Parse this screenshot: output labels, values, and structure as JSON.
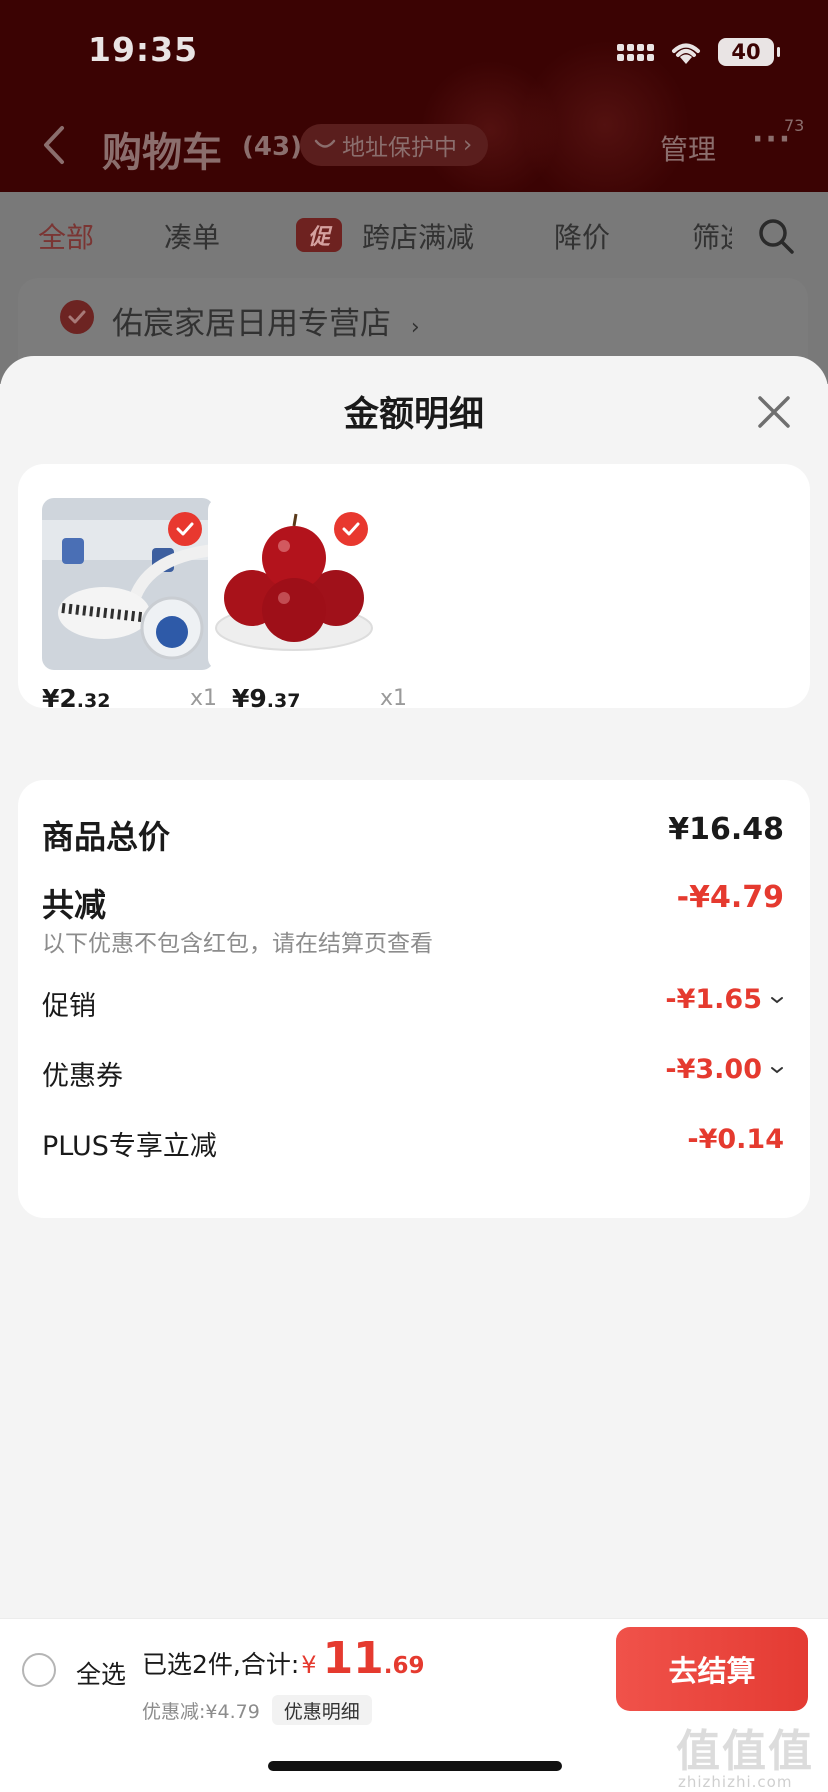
{
  "status_bar": {
    "time": "19:35",
    "battery": "40"
  },
  "nav": {
    "title": "购物车",
    "count": "(43)",
    "address_protect": "地址保护中",
    "manage": "管理",
    "more": "···",
    "badge": "73"
  },
  "filters": {
    "tabs": [
      "全部",
      "凑单",
      "跨店满减",
      "降价",
      "筛选"
    ],
    "promo_tag": "促"
  },
  "store": {
    "name": "佑宸家居日用专营店"
  },
  "sheet": {
    "title": "金额明细",
    "goods": [
      {
        "name": "toilet-brush",
        "price_int": "¥2",
        "price_dec": ".32",
        "qty": "x1"
      },
      {
        "name": "red-apples",
        "price_int": "¥9",
        "price_dec": ".37",
        "qty": "x1"
      }
    ],
    "summary": {
      "total_label": "商品总价",
      "total_value": "¥16.48",
      "reduce_label": "共减",
      "reduce_value": "-¥4.79",
      "reduce_note": "以下优惠不包含红包，请在结算页查看",
      "promo_label": "促销",
      "promo_value": "-¥1.65",
      "coupon_label": "优惠券",
      "coupon_value": "-¥3.00",
      "plus_label": "PLUS专享立减",
      "plus_value": "-¥0.14"
    }
  },
  "bottom_bar": {
    "select_all": "全选",
    "selected_text": "已选2件,合计:",
    "currency": "¥",
    "total_int": "11",
    "total_dec": ".69",
    "discount_text": "优惠减:¥4.79",
    "detail_button": "优惠明细",
    "checkout": "去结算"
  },
  "watermark": {
    "main": "值值值",
    "sub": "zhizhizhi.com"
  },
  "colors": {
    "accent_red": "#e53a2f",
    "header_dark": "#3b0303"
  }
}
